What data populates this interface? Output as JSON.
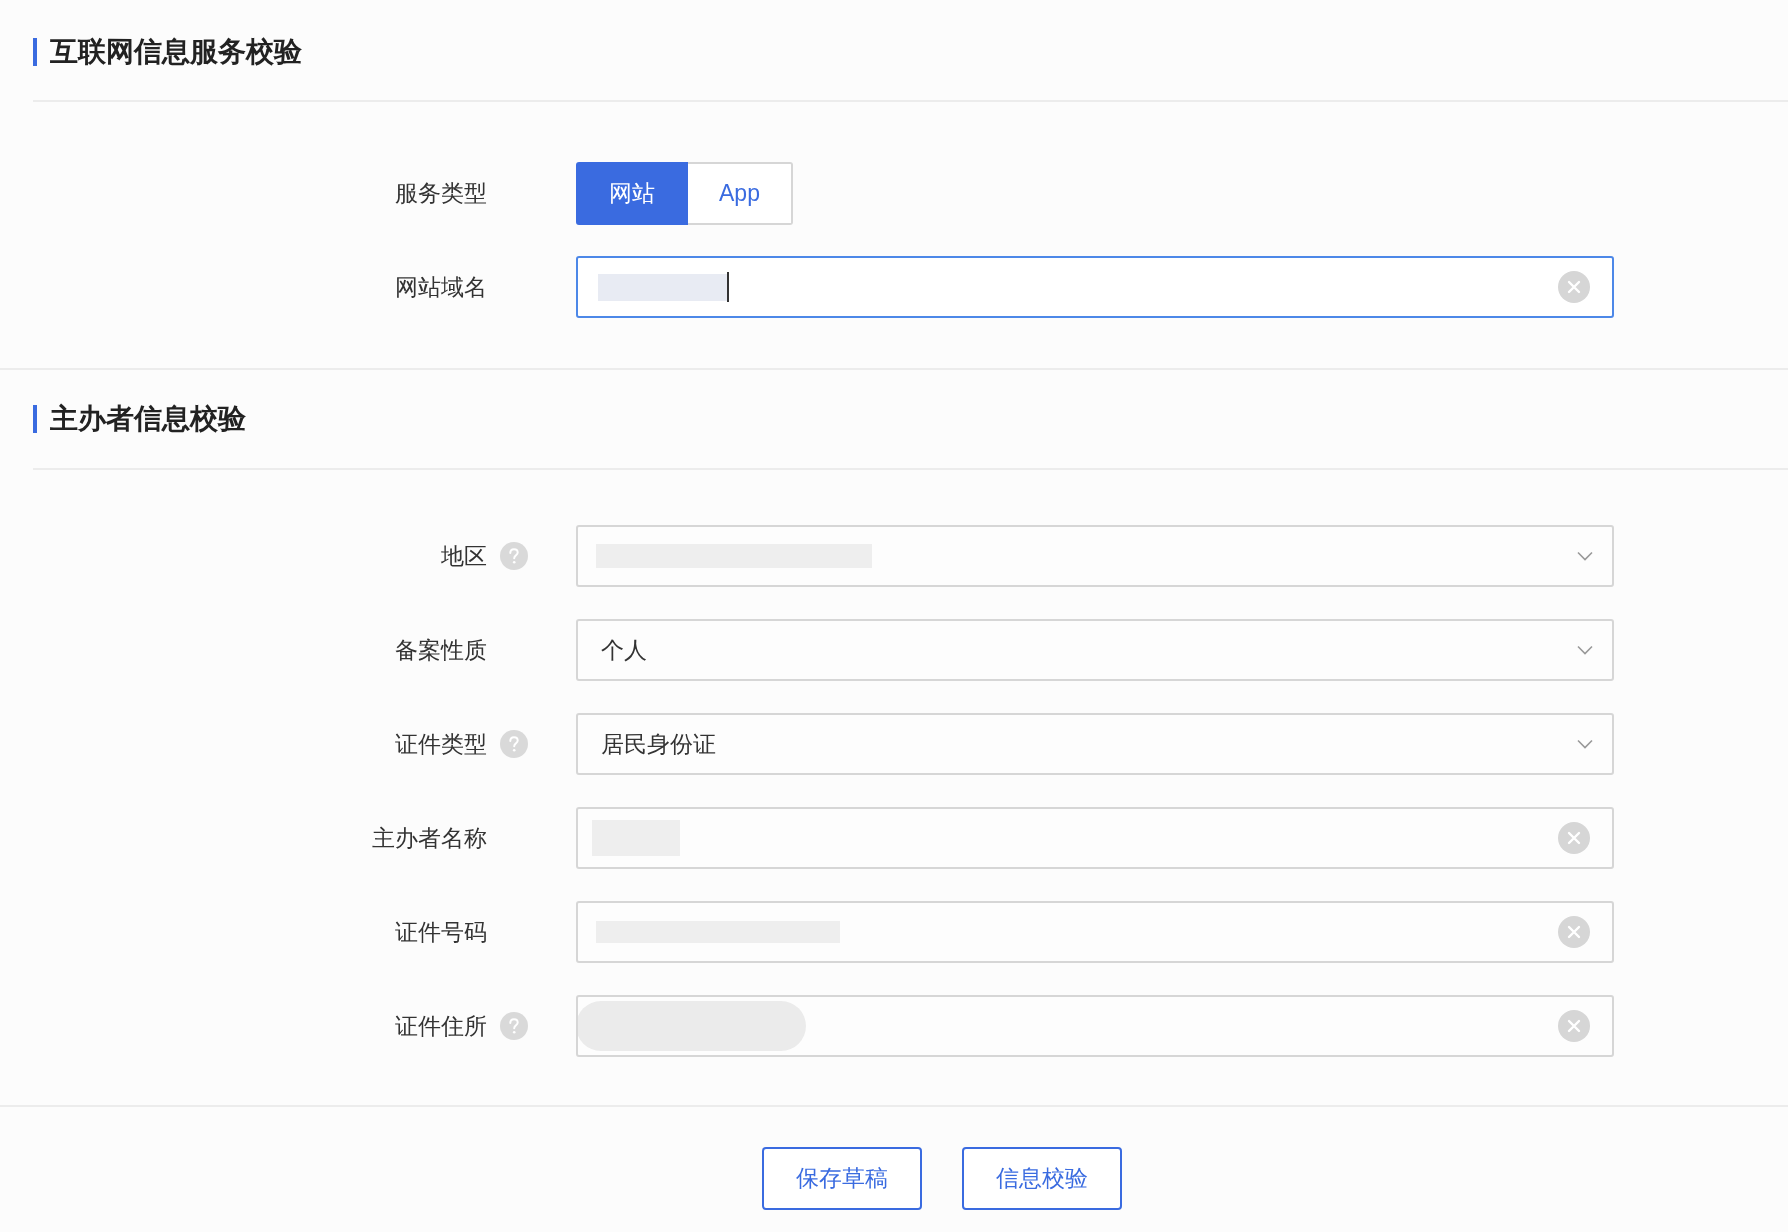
{
  "sections": [
    {
      "title": "互联网信息服务校验",
      "fields": [
        {
          "label": "服务类型",
          "kind": "segmented",
          "help": false,
          "options": [
            {
              "label": "网站",
              "selected": true
            },
            {
              "label": "App",
              "selected": false
            }
          ]
        },
        {
          "label": "网站域名",
          "kind": "input",
          "help": false,
          "focused": true,
          "redacted": true
        }
      ]
    },
    {
      "title": "主办者信息校验",
      "fields": [
        {
          "label": "地区",
          "kind": "select",
          "help": true,
          "focused": false,
          "redacted": true
        },
        {
          "label": "备案性质",
          "kind": "select",
          "help": false,
          "focused": false,
          "redacted": false,
          "value": "个人"
        },
        {
          "label": "证件类型",
          "kind": "select",
          "help": true,
          "focused": false,
          "redacted": false,
          "value": "居民身份证"
        },
        {
          "label": "主办者名称",
          "kind": "input",
          "help": false,
          "focused": false,
          "redacted": true
        },
        {
          "label": "证件号码",
          "kind": "input",
          "help": false,
          "focused": false,
          "redacted": true
        },
        {
          "label": "证件住所",
          "kind": "input",
          "help": true,
          "focused": false,
          "redacted": true
        }
      ]
    }
  ],
  "buttons": [
    "保存草稿",
    "信息校验"
  ]
}
